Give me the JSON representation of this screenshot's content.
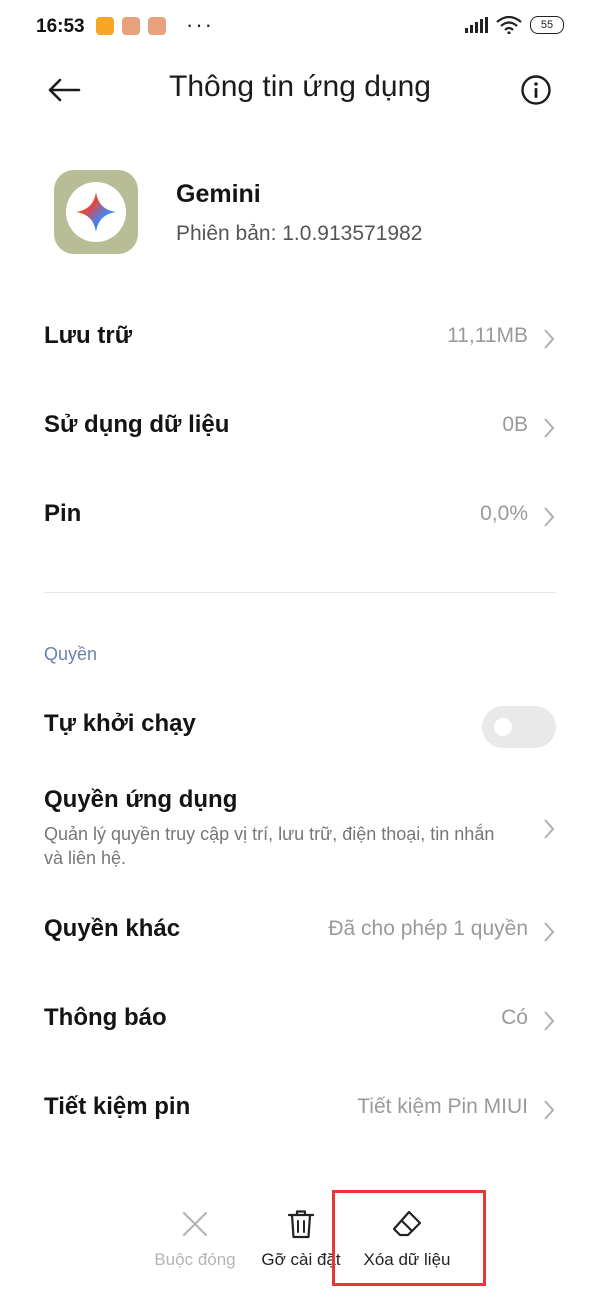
{
  "status_bar": {
    "time": "16:53",
    "battery": "55",
    "more": "···"
  },
  "header": {
    "title": "Thông tin ứng dụng"
  },
  "app": {
    "name": "Gemini",
    "version": "Phiên bản: 1.0.913571982"
  },
  "rows": {
    "storage": {
      "label": "Lưu trữ",
      "value": "11,11MB"
    },
    "data_usage": {
      "label": "Sử dụng dữ liệu",
      "value": "0B"
    },
    "battery": {
      "label": "Pin",
      "value": "0,0%"
    }
  },
  "permissions_section": {
    "heading": "Quyền",
    "autostart": {
      "label": "Tự khởi chạy",
      "enabled": false
    },
    "app_permissions": {
      "label": "Quyền ứng dụng",
      "description": "Quản lý quyền truy cập vị trí, lưu trữ, điện thoại, tin nhắn và liên hệ."
    },
    "other_permissions": {
      "label": "Quyền khác",
      "value": "Đã cho phép 1 quyền"
    },
    "notifications": {
      "label": "Thông báo",
      "value": "Có"
    },
    "battery_saver": {
      "label": "Tiết kiệm pin",
      "value": "Tiết kiệm Pin MIUI"
    }
  },
  "bottom_actions": {
    "force_stop": {
      "label": "Buộc đóng",
      "enabled": false
    },
    "uninstall": {
      "label": "Gỡ cài đặt",
      "enabled": true
    },
    "clear_data": {
      "label": "Xóa dữ liệu",
      "enabled": true
    }
  },
  "colors": {
    "accent_section": "#6b82b0",
    "highlight": "#e53935",
    "app_icon_bg": "#b9bd97",
    "notif_orange": "#f5a623",
    "notif_pink": "#e8a27b"
  },
  "icons": {
    "back": "arrow-left-icon",
    "info": "info-circle-icon",
    "chevron": "chevron-right-icon",
    "force_stop": "close-x-icon",
    "uninstall": "trash-icon",
    "clear_data": "eraser-icon",
    "app": "gemini-sparkle-icon"
  }
}
